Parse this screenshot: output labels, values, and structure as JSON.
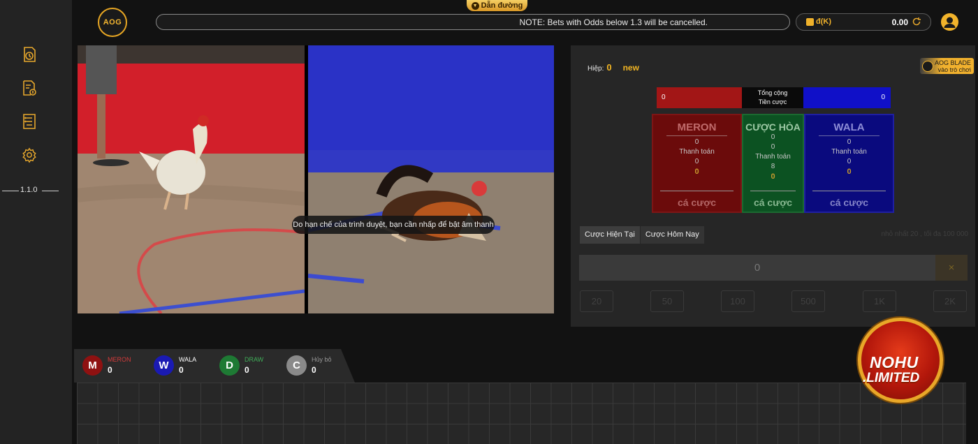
{
  "header": {
    "logo_text": "AOG",
    "guide_label": "Dẫn đường",
    "notice": "NOTE: Bets with Odds below 1.3 will be cancelled.",
    "currency": "đ(K)",
    "balance": "0.00"
  },
  "sidebar": {
    "icons": [
      "history-icon",
      "bet-slip-icon",
      "report-icon",
      "settings-icon"
    ],
    "version": "1.1.0"
  },
  "video": {
    "audio_hint": "Do hạn chế của trình duyệt, bạn cần nhấp để bật âm thanh"
  },
  "bet_panel": {
    "round_label": "Hiệp:",
    "round_number": "0",
    "round_status": "new",
    "blade_line1": "AOG BLADE",
    "blade_line2": "vào trò chơi",
    "total_label_1": "Tổng cộng",
    "total_label_2": "Tiền cược",
    "meron_total": "0",
    "wala_total": "0",
    "sides": [
      {
        "name": "MERON",
        "values": [
          "0",
          "0",
          "0"
        ],
        "payout_label": "Thanh toán",
        "action": "cá cược"
      },
      {
        "name": "CƯỢC HÒA",
        "values": [
          "0",
          "0",
          "8",
          "0"
        ],
        "payout_label": "Thanh toán",
        "action": "cá cược"
      },
      {
        "name": "WALA",
        "values": [
          "0",
          "0",
          "0"
        ],
        "payout_label": "Thanh toán",
        "action": "cá cược"
      }
    ],
    "tabs": [
      "Cược Hiện Tại",
      "Cược Hôm Nay"
    ],
    "limits": "nhỏ nhất 20 , tối đa 100 000",
    "amount": "0",
    "clear_label": "×",
    "chips": [
      "20",
      "50",
      "100",
      "500",
      "1K",
      "2K"
    ]
  },
  "results": {
    "legend": [
      {
        "letter": "M",
        "label": "MERON",
        "count": "0",
        "color": "#8f1111",
        "label_color": "#d33b3b"
      },
      {
        "letter": "W",
        "label": "WALA",
        "count": "0",
        "color": "#1a1ab3",
        "label_color": "#ffffff"
      },
      {
        "letter": "D",
        "label": "DRAW",
        "count": "0",
        "color": "#1e7a34",
        "label_color": "#3fae58"
      },
      {
        "letter": "C",
        "label": "Hủy bỏ",
        "count": "0",
        "color": "#8a8a8a",
        "label_color": "#9a9a9a"
      }
    ]
  },
  "watermark": {
    "line1": "NOHU",
    "line2": ".LIMITED"
  },
  "colors": {
    "accent": "#f2b523",
    "meron": "#a21616",
    "wala": "#1010c8",
    "draw": "#0c5222"
  }
}
